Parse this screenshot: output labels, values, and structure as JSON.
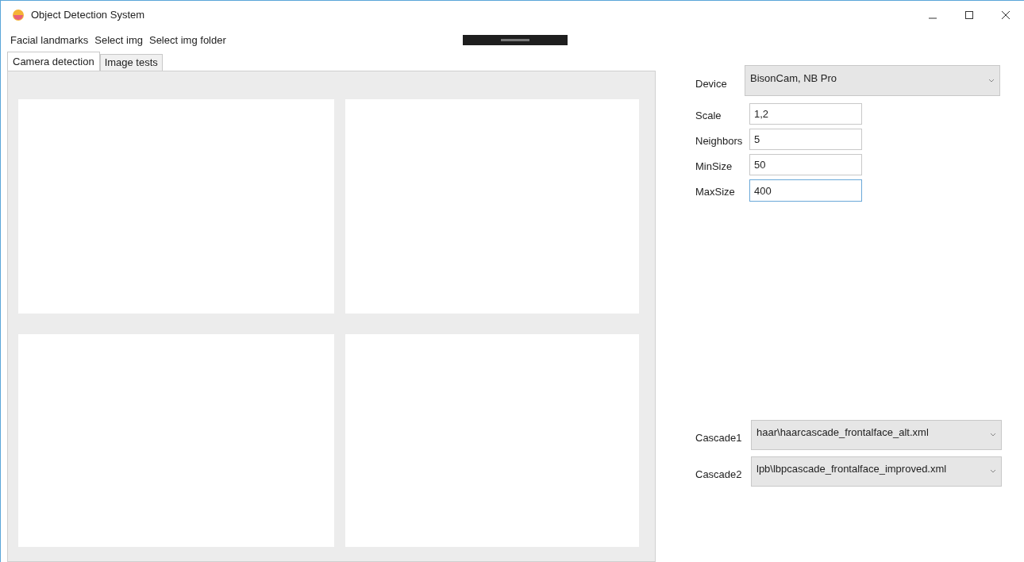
{
  "window": {
    "title": "Object Detection System"
  },
  "menu": [
    "Facial landmarks",
    "Select img",
    "Select img folder"
  ],
  "tabs": [
    {
      "label": "Camera detection",
      "selected": true
    },
    {
      "label": "Image tests",
      "selected": false
    }
  ],
  "views": [
    {
      "kind": "picture"
    },
    {
      "kind": "picture"
    },
    {
      "kind": "picture"
    },
    {
      "kind": "picture"
    }
  ],
  "device": {
    "label": "Device",
    "value": "BisonCam, NB Pro"
  },
  "fields": [
    {
      "label": "Scale",
      "value": "1,2",
      "focused": false
    },
    {
      "label": "Neighbors",
      "value": "5",
      "focused": false
    },
    {
      "label": "MinSize",
      "value": "50",
      "focused": false
    },
    {
      "label": "MaxSize",
      "value": "400",
      "focused": true
    }
  ],
  "cascades": [
    {
      "label": "Cascade1",
      "value": "haar\\haarcascade_frontalface_alt.xml"
    },
    {
      "label": "Cascade2",
      "value": "lpb\\lbpcascade_frontalface_improved.xml"
    }
  ]
}
